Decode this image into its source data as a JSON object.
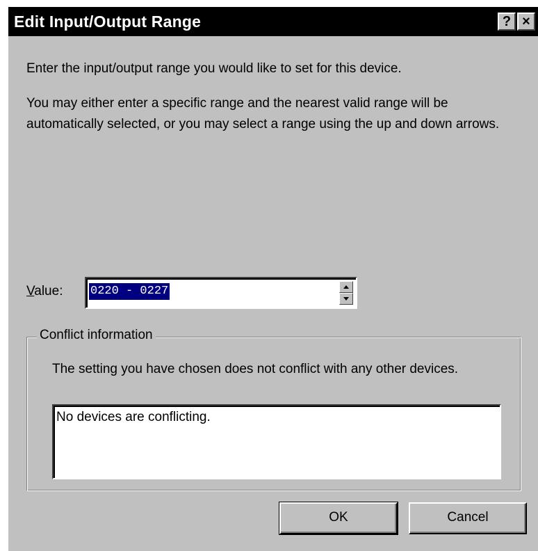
{
  "window": {
    "title": "Edit Input/Output Range",
    "help_label": "?",
    "close_label": "×"
  },
  "instructions": {
    "line1": "Enter the input/output range you would like to set for this device.",
    "line2": "You may either enter a specific range and the nearest valid range will be automatically selected, or you may select a range using the up and down arrows."
  },
  "value": {
    "label_accel": "V",
    "label_rest": "alue:",
    "current": "0220 - 0227"
  },
  "conflict": {
    "legend": "Conflict information",
    "description": "The setting you have chosen does not conflict with any other devices.",
    "details": "No devices are conflicting."
  },
  "buttons": {
    "ok": "OK",
    "cancel": "Cancel"
  },
  "colors": {
    "dialog_face": "#c0c0c0",
    "titlebar": "#000000",
    "selection": "#000080"
  }
}
